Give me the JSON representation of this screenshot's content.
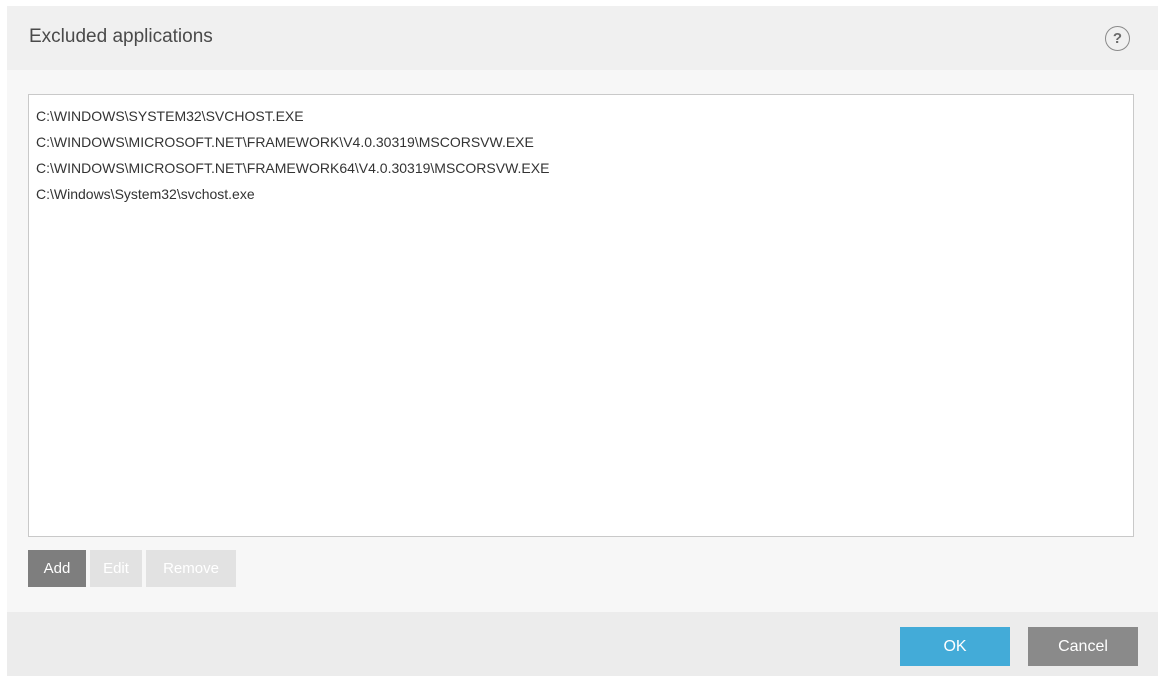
{
  "dialog": {
    "title": "Excluded applications",
    "help_label": "?"
  },
  "list": {
    "items": [
      "C:\\WINDOWS\\SYSTEM32\\SVCHOST.EXE",
      "C:\\WINDOWS\\MICROSOFT.NET\\FRAMEWORK\\V4.0.30319\\MSCORSVW.EXE",
      "C:\\WINDOWS\\MICROSOFT.NET\\FRAMEWORK64\\V4.0.30319\\MSCORSVW.EXE",
      "C:\\Windows\\System32\\svchost.exe"
    ]
  },
  "list_buttons": {
    "add": "Add",
    "edit": "Edit",
    "remove": "Remove"
  },
  "footer": {
    "ok": "OK",
    "cancel": "Cancel"
  },
  "colors": {
    "ok_button": "#43abd8",
    "cancel_button": "#8a8a8a",
    "add_button": "#7e7e7e",
    "disabled_button": "#e2e2e2"
  }
}
